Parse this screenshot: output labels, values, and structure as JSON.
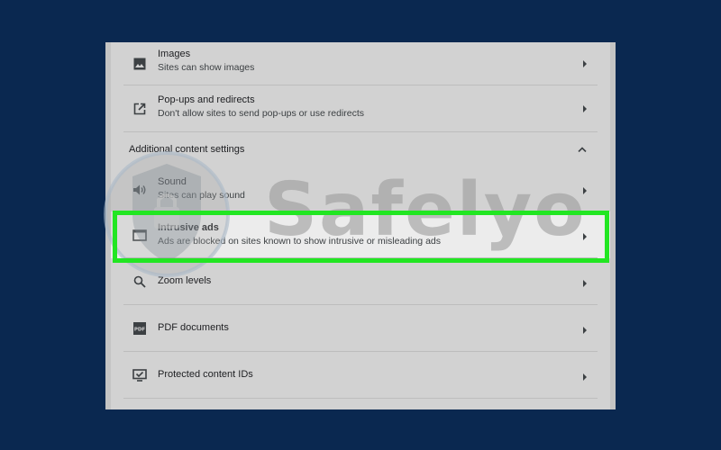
{
  "settings": {
    "rows": [
      {
        "title": "Images",
        "subtitle": "Sites can show images",
        "icon": "image-icon"
      },
      {
        "title": "Pop-ups and redirects",
        "subtitle": "Don't allow sites to send pop-ups or use redirects",
        "icon": "open-in-new-icon"
      },
      {
        "title": "Sound",
        "subtitle": "Sites can play sound",
        "icon": "speaker-icon"
      },
      {
        "title": "Intrusive ads",
        "subtitle": "Ads are blocked on sites known to show intrusive or misleading ads",
        "icon": "browser-window-icon"
      },
      {
        "title": "Zoom levels",
        "icon": "magnifier-icon"
      },
      {
        "title": "PDF documents",
        "icon": "pdf-icon"
      },
      {
        "title": "Protected content IDs",
        "icon": "protected-content-icon"
      }
    ],
    "additional_section_label": "Additional content settings"
  },
  "highlight": {
    "color": "#22e622",
    "target": "Intrusive ads"
  },
  "watermark": {
    "text": "Safelyo"
  },
  "colors": {
    "background": "#0a2850",
    "panel": "#d2d2d2"
  }
}
